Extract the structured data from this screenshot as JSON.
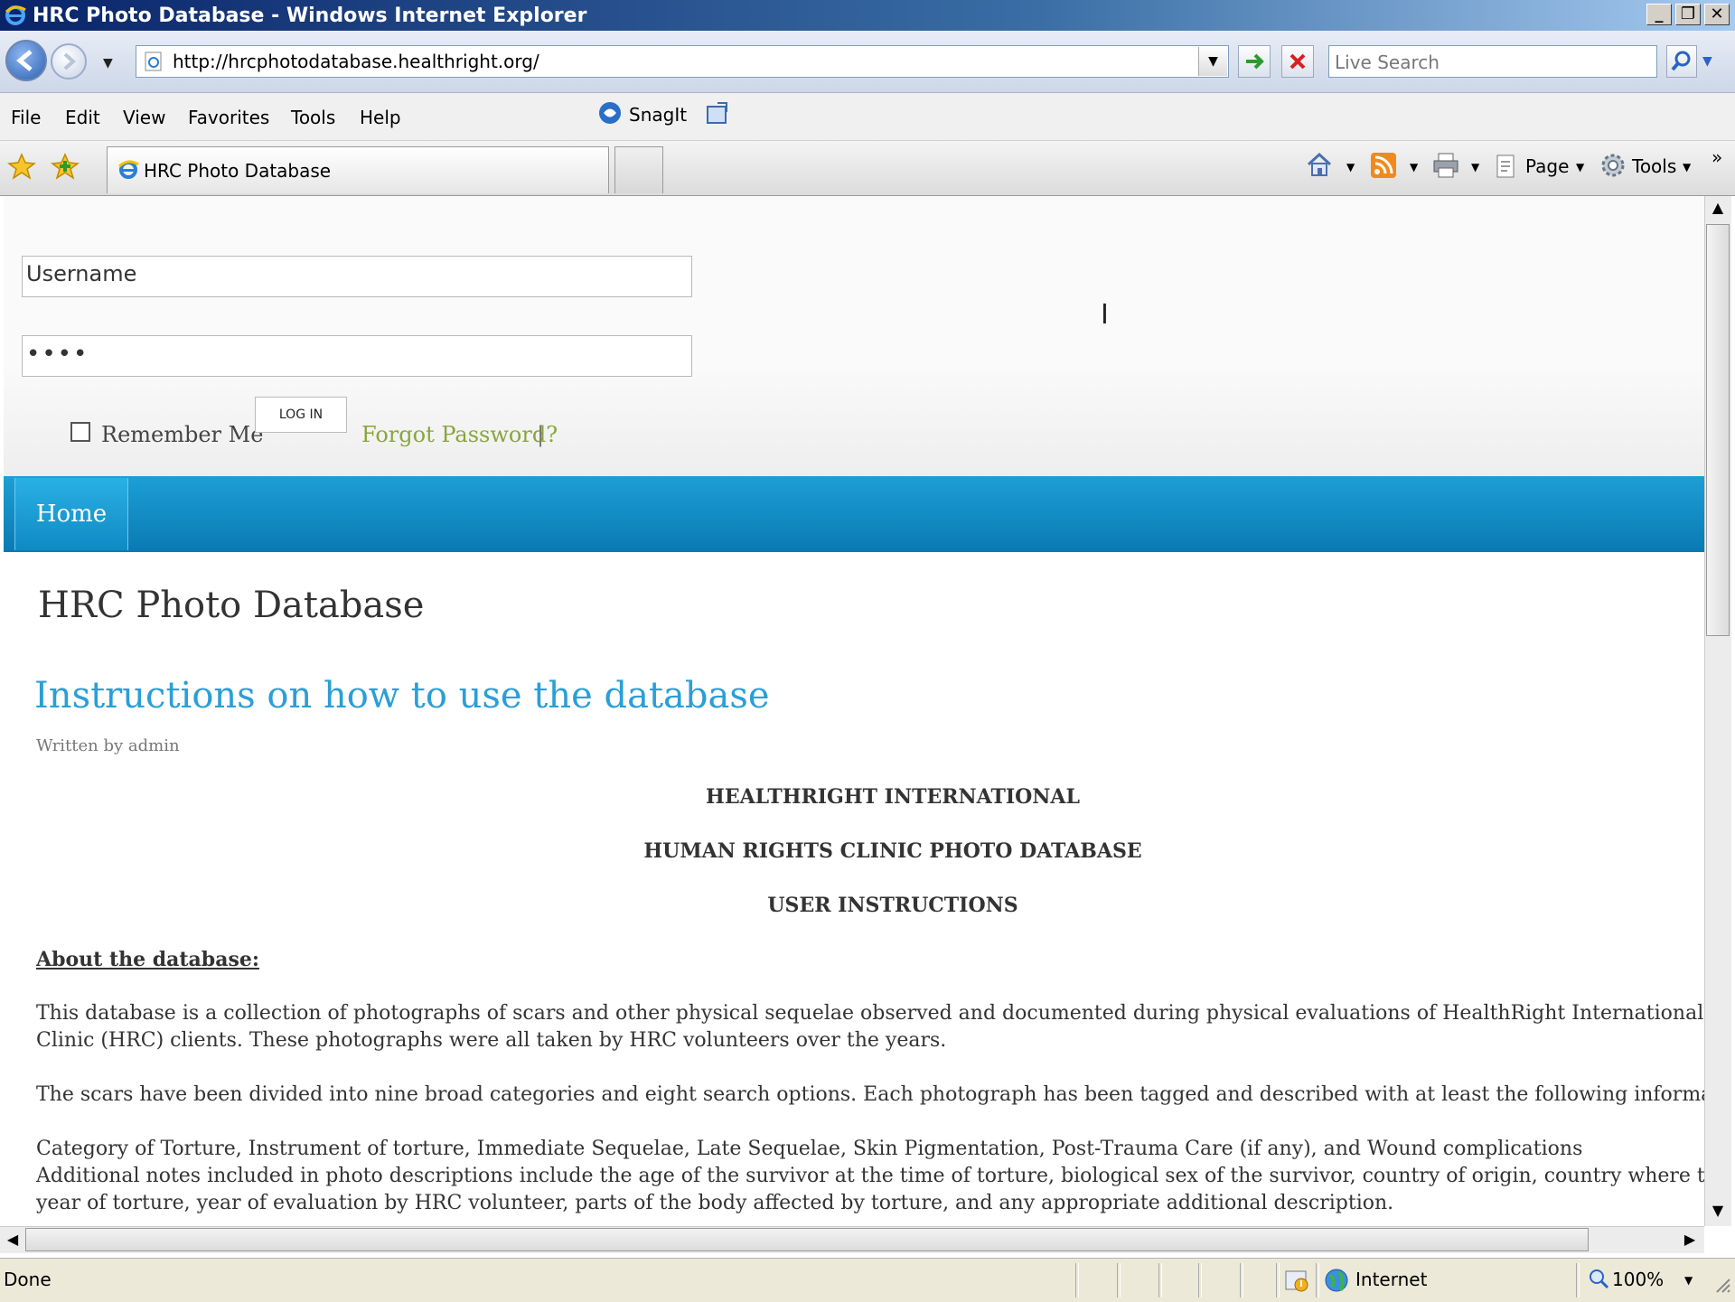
{
  "window": {
    "title": "HRC Photo Database - Windows Internet Explorer"
  },
  "address": {
    "url": "http://hrcphotodatabase.healthright.org/"
  },
  "search": {
    "placeholder": "Live Search"
  },
  "menu": [
    "File",
    "Edit",
    "View",
    "Favorites",
    "Tools",
    "Help"
  ],
  "snagit": "SnagIt",
  "tab": {
    "label": "HRC Photo Database"
  },
  "toolbar": {
    "page_label": "Page",
    "tools_label": "Tools"
  },
  "login": {
    "username_value": "Username",
    "password_value": "••••",
    "remember_label": "Remember Me",
    "login_button": "LOG IN",
    "forgot_link": "Forgot Password?",
    "separator": "|"
  },
  "nav": {
    "home": "Home"
  },
  "content": {
    "site_title": "HRC Photo Database",
    "article_title": "Instructions on how to use the database",
    "byline": "Written by admin",
    "heading1": "HEALTHRIGHT INTERNATIONAL",
    "heading2": "HUMAN RIGHTS CLINIC PHOTO DATABASE",
    "heading3": "USER INSTRUCTIONS",
    "about_heading": "About the database:",
    "para1_line1": "This database is a collection of photographs of scars and other physical sequelae observed and documented during physical evaluations of HealthRight International's Human Ri",
    "para1_line2": "Clinic (HRC) clients.  These photographs were all taken by HRC volunteers over the years.",
    "para2": "The scars have been divided into nine broad categories and eight search options. Each photograph has been tagged and described with at least the following information:",
    "para3_line1": "Category of Torture, Instrument of torture, Immediate Sequelae, Late Sequelae,  Skin Pigmentation, Post-Trauma Care (if any), and Wound complications",
    "para3_line2": "Additional notes included in photo descriptions include the age of the survivor at the time of torture, biological sex of the survivor, country of origin, country where torture occurr",
    "para3_line3": "year of torture, year of evaluation by HRC volunteer, parts of the body affected by torture, and any appropriate additional description."
  },
  "status": {
    "text": "Done",
    "zone": "Internet",
    "zoom": "100%"
  }
}
